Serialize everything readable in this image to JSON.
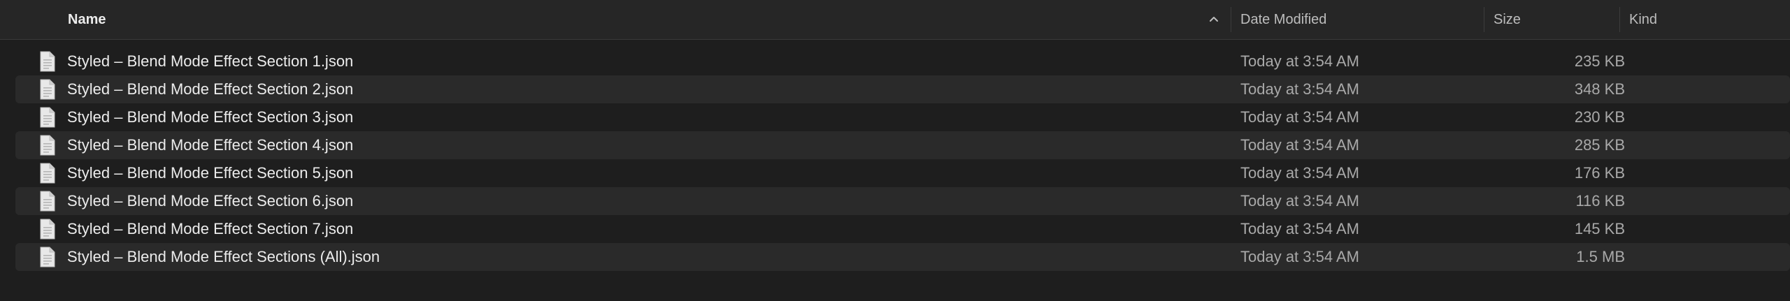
{
  "columns": {
    "name": "Name",
    "date_modified": "Date Modified",
    "size": "Size",
    "kind": "Kind"
  },
  "sort": {
    "column": "name",
    "direction": "ascending",
    "indicator_icon": "chevron-up-icon"
  },
  "files": [
    {
      "name": "Styled – Blend Mode Effect Section 1.json",
      "date_modified": "Today at 3:54 AM",
      "size": "235 KB",
      "kind": "",
      "icon": "document-icon"
    },
    {
      "name": "Styled – Blend Mode Effect Section 2.json",
      "date_modified": "Today at 3:54 AM",
      "size": "348 KB",
      "kind": "",
      "icon": "document-icon"
    },
    {
      "name": "Styled – Blend Mode Effect Section 3.json",
      "date_modified": "Today at 3:54 AM",
      "size": "230 KB",
      "kind": "",
      "icon": "document-icon"
    },
    {
      "name": "Styled – Blend Mode Effect Section 4.json",
      "date_modified": "Today at 3:54 AM",
      "size": "285 KB",
      "kind": "",
      "icon": "document-icon"
    },
    {
      "name": "Styled – Blend Mode Effect Section 5.json",
      "date_modified": "Today at 3:54 AM",
      "size": "176 KB",
      "kind": "",
      "icon": "document-icon"
    },
    {
      "name": "Styled – Blend Mode Effect Section 6.json",
      "date_modified": "Today at 3:54 AM",
      "size": "116 KB",
      "kind": "",
      "icon": "document-icon"
    },
    {
      "name": "Styled – Blend Mode Effect Section 7.json",
      "date_modified": "Today at 3:54 AM",
      "size": "145 KB",
      "kind": "",
      "icon": "document-icon"
    },
    {
      "name": "Styled – Blend Mode Effect Sections (All).json",
      "date_modified": "Today at 3:54 AM",
      "size": "1.5 MB",
      "kind": "",
      "icon": "document-icon"
    }
  ],
  "colors": {
    "background": "#1e1e1e",
    "header_background": "#262626",
    "alternate_row": "#2a2a2a",
    "primary_text": "#ececec",
    "secondary_text": "#a9a9a9"
  }
}
